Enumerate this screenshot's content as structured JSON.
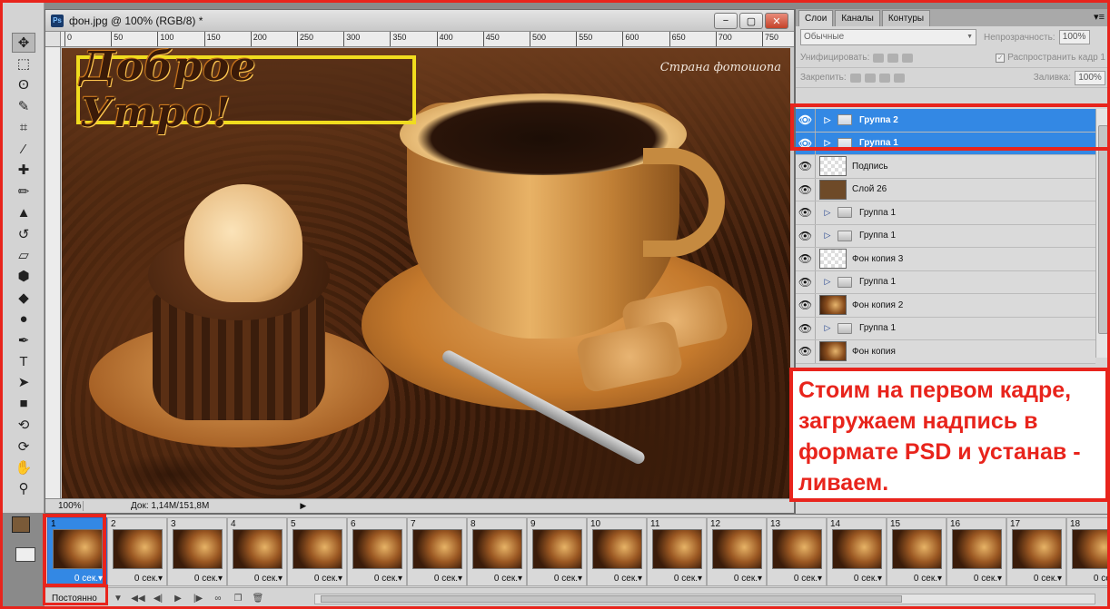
{
  "document": {
    "title": "фон.jpg @ 100% (RGB/8) *",
    "app_badge": "Ps",
    "ruler_ticks": [
      "0",
      "50",
      "100",
      "150",
      "200",
      "250",
      "300",
      "350",
      "400",
      "450",
      "500",
      "550",
      "600",
      "650",
      "700",
      "750"
    ],
    "zoom": "100%",
    "doc_info": "Док: 1,14M/151,8M",
    "greeting_text": "Доброе Утро!",
    "watermark": "Страна фотошопа",
    "window_buttons": [
      "−",
      "▢",
      "✕"
    ]
  },
  "layers_panel": {
    "tabs": [
      "Слои",
      "Каналы",
      "Контуры"
    ],
    "blend_mode": "Обычные",
    "opacity_label": "Непрозрачность:",
    "opacity_value": "100%",
    "unify_label": "Унифицировать:",
    "propagate_label": "Распространить кадр 1",
    "lock_label": "Закрепить:",
    "fill_label": "Заливка:",
    "fill_value": "100%",
    "layers": [
      {
        "name": "Группа 2",
        "kind": "group",
        "selected": true
      },
      {
        "name": "Группа 1",
        "kind": "group",
        "selected": true
      },
      {
        "name": "Подпись",
        "kind": "checker",
        "selected": false
      },
      {
        "name": "Слой 26",
        "kind": "brown",
        "selected": false
      },
      {
        "name": "Группа 1",
        "kind": "group",
        "selected": false
      },
      {
        "name": "Группа 1",
        "kind": "group",
        "selected": false
      },
      {
        "name": "Фон копия 3",
        "kind": "checker",
        "selected": false
      },
      {
        "name": "Группа 1",
        "kind": "group",
        "selected": false
      },
      {
        "name": "Фон копия 2",
        "kind": "photo",
        "selected": false
      },
      {
        "name": "Группа 1",
        "kind": "group",
        "selected": false
      },
      {
        "name": "Фон копия",
        "kind": "photo",
        "selected": false
      }
    ]
  },
  "callout": {
    "text": "Стоим на первом кадре, загружаем надпись в формате PSD и устанав - ливаем."
  },
  "animation": {
    "frames": [
      "1",
      "2",
      "3",
      "4",
      "5",
      "6",
      "7",
      "8",
      "9",
      "10",
      "11",
      "12",
      "13",
      "14",
      "15",
      "16",
      "17",
      "18"
    ],
    "delay": "0 сек.",
    "selected_frame": "1",
    "loop": "Постоянно"
  },
  "colors": {
    "accent_red": "#e8241c",
    "selection_blue": "#3388e4",
    "highlight_yellow": "#f0dc1e"
  }
}
